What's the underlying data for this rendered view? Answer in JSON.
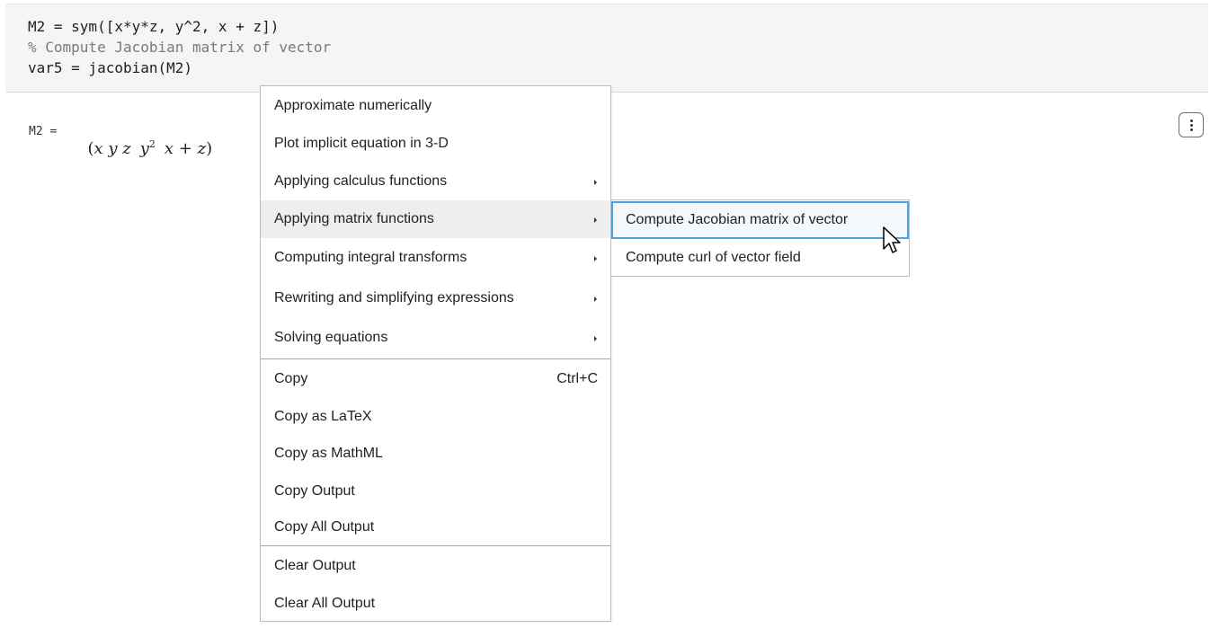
{
  "code": {
    "line1": "M2 = sym([x*y*z, y^2, x + z])",
    "line2": "% Compute Jacobian matrix of vector",
    "line3": "var5 = jacobian(M2)"
  },
  "output": {
    "label": "M2 =",
    "math": {
      "open_paren": "(",
      "element1": "x y z",
      "element2_base": "y",
      "element2_exp": "2",
      "element3": "x + z",
      "close_paren": ")"
    }
  },
  "more_button": {
    "icon": "vertical-ellipsis-icon"
  },
  "context_menu": {
    "items": [
      {
        "label": "Approximate numerically",
        "has_submenu": false
      },
      {
        "label": "Plot implicit equation in 3-D",
        "has_submenu": false
      },
      {
        "label": "Applying calculus functions",
        "has_submenu": true
      },
      {
        "label": "Applying matrix functions",
        "has_submenu": true,
        "highlighted": true
      },
      {
        "label": "Computing integral transforms",
        "has_submenu": true
      },
      {
        "label": "Rewriting and simplifying expressions",
        "has_submenu": true
      },
      {
        "label": "Solving equations",
        "has_submenu": true
      }
    ],
    "clipboard_items": [
      {
        "label": "Copy",
        "shortcut": "Ctrl+C"
      },
      {
        "label": "Copy as LaTeX"
      },
      {
        "label": "Copy as MathML"
      },
      {
        "label": "Copy Output"
      },
      {
        "label": "Copy All Output"
      }
    ],
    "clear_items": [
      {
        "label": "Clear Output"
      },
      {
        "label": "Clear All Output"
      }
    ]
  },
  "submenu": {
    "items": [
      {
        "label": "Compute Jacobian matrix of vector",
        "focused": true
      },
      {
        "label": "Compute curl of vector field"
      }
    ]
  },
  "colors": {
    "code_background": "#f5f5f5",
    "comment": "#7a7a7a",
    "focus_border": "#4ea1e0",
    "hover_background": "#eeeeee"
  }
}
